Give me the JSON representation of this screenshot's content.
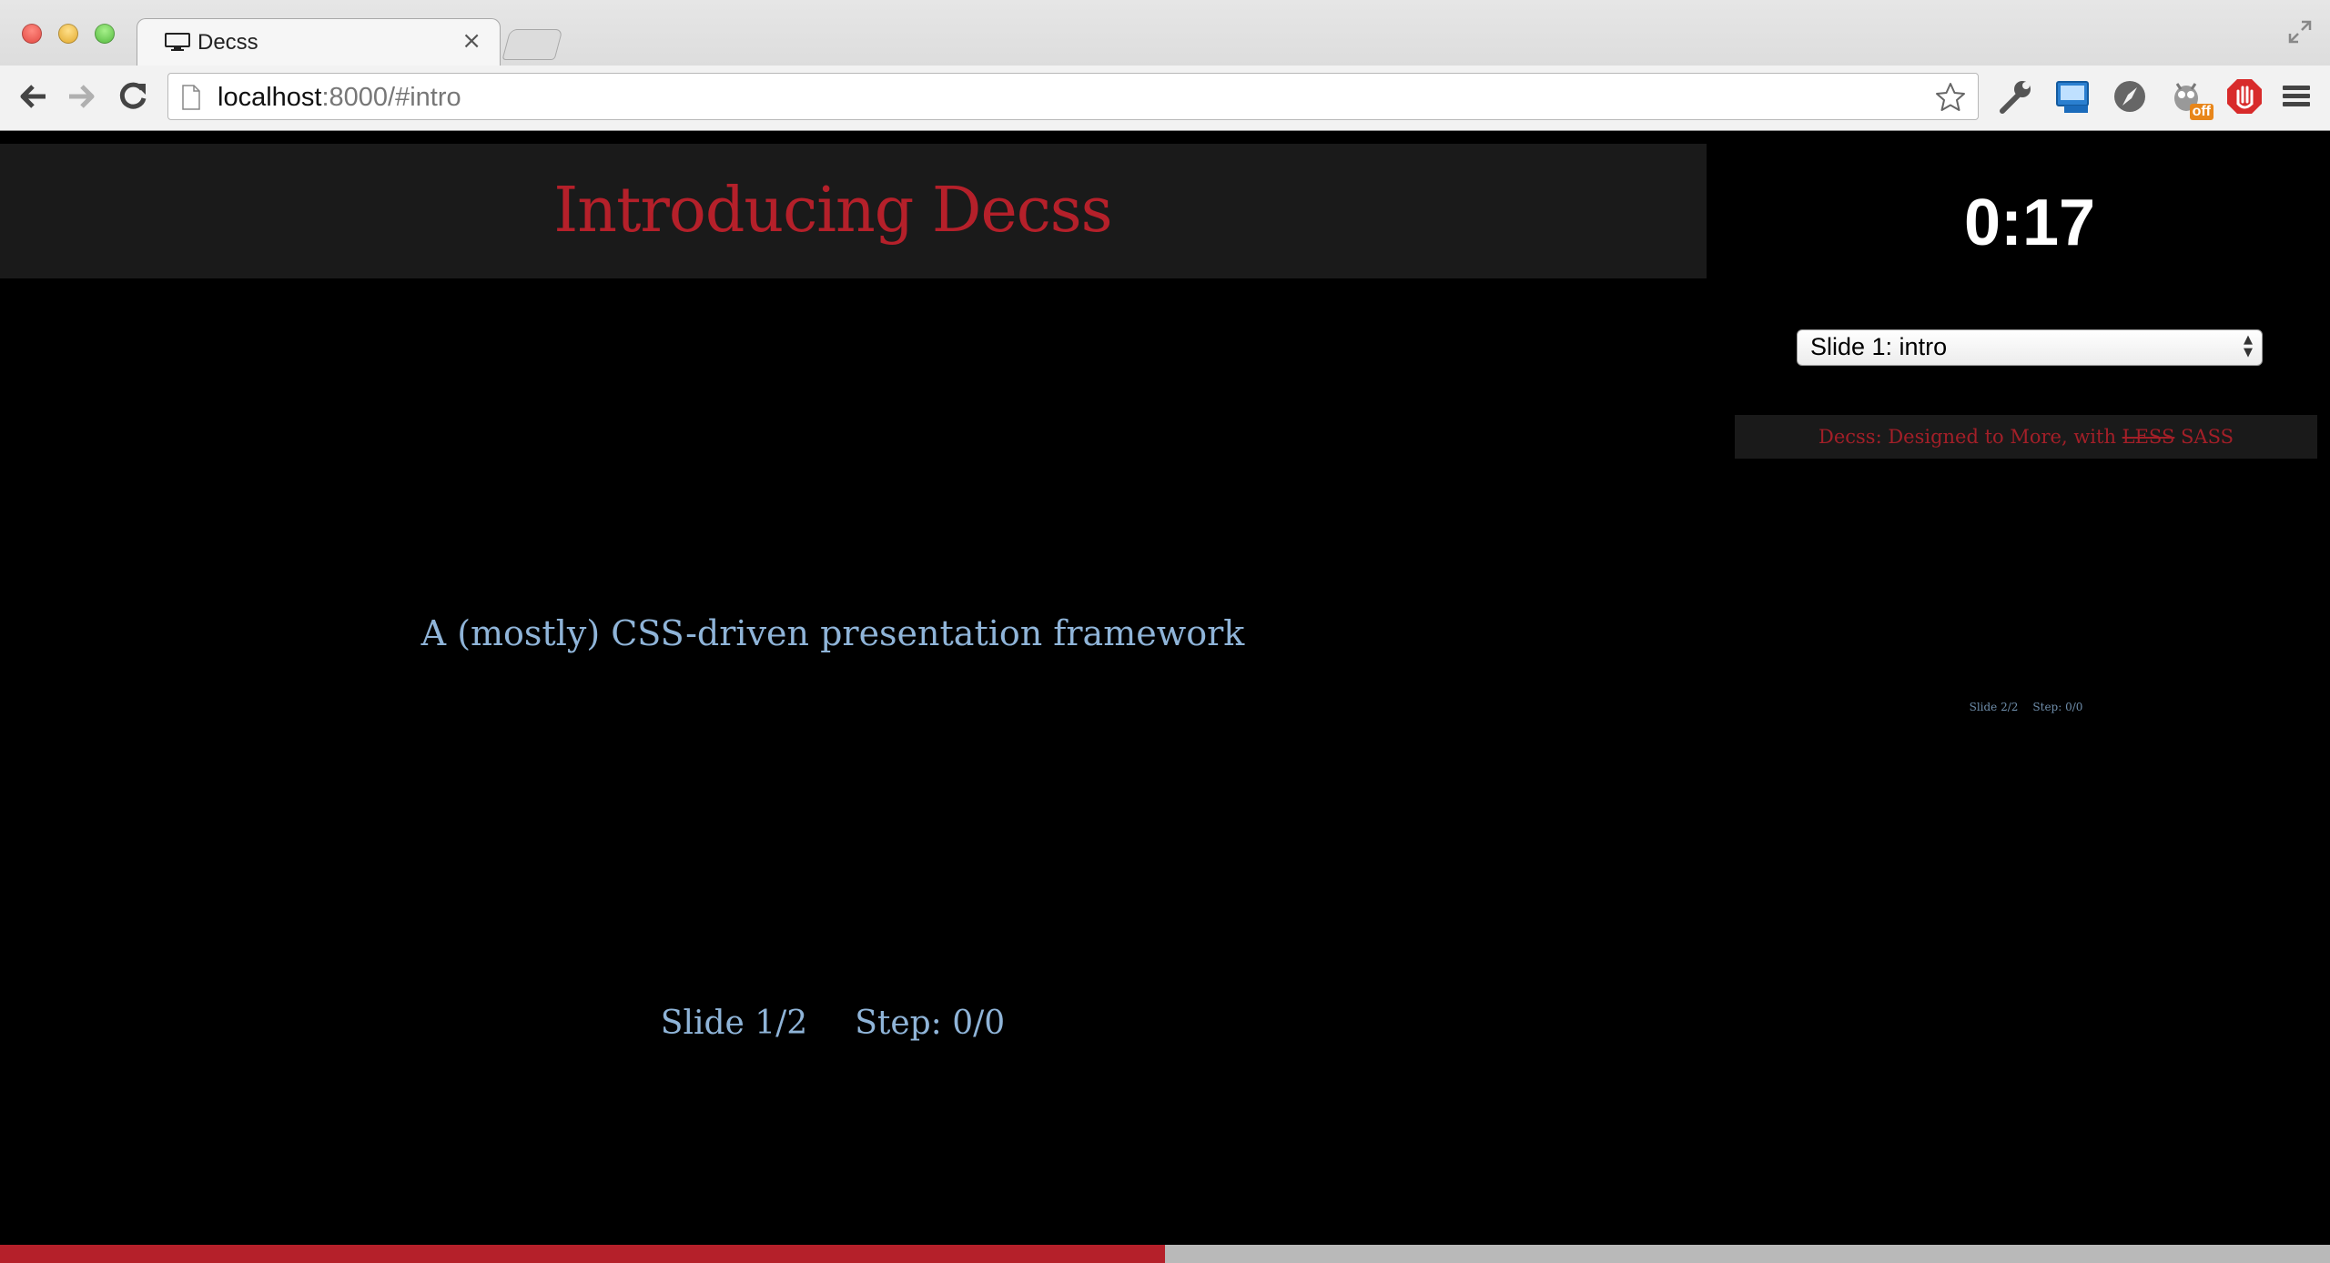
{
  "browser": {
    "tab_title": "Decss",
    "tab_close": "×",
    "url_host": "localhost",
    "url_rest": ":8000/#intro",
    "extensions": [
      "wrench-icon",
      "screenshot-icon",
      "compass-icon",
      "bug-icon",
      "adblock-icon"
    ],
    "extension_badge": "off"
  },
  "slide": {
    "title": "Introducing Decss",
    "subtitle": "A (mostly) CSS-driven presentation framework",
    "slide_counter": "Slide 1/2",
    "step_counter": "Step: 0/0"
  },
  "presenter": {
    "timer": "0:17",
    "slide_select_value": "Slide 1: intro",
    "next_preview": {
      "title_prefix": "Decss: Designed to More, with ",
      "title_struck": "LESS",
      "title_suffix": " SASS",
      "slide_counter": "Slide 2/2",
      "step_counter": "Step: 0/0"
    }
  },
  "progress": {
    "fraction": 0.5
  },
  "colors": {
    "accent_red": "#b5202a",
    "text_blue": "#8fb4d8",
    "header_bg": "#1a1a1a"
  }
}
